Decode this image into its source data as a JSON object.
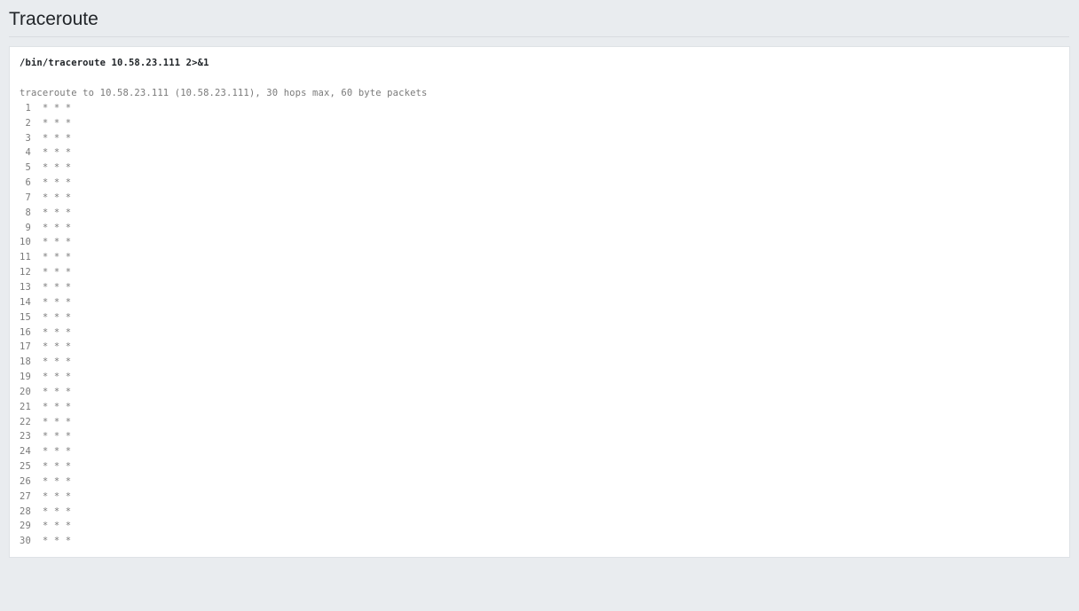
{
  "page": {
    "title": "Traceroute"
  },
  "output": {
    "command": "/bin/traceroute 10.58.23.111 2>&1",
    "header": "traceroute to 10.58.23.111 (10.58.23.111), 30 hops max, 60 byte packets",
    "hops": [
      " 1  * * *",
      " 2  * * *",
      " 3  * * *",
      " 4  * * *",
      " 5  * * *",
      " 6  * * *",
      " 7  * * *",
      " 8  * * *",
      " 9  * * *",
      "10  * * *",
      "11  * * *",
      "12  * * *",
      "13  * * *",
      "14  * * *",
      "15  * * *",
      "16  * * *",
      "17  * * *",
      "18  * * *",
      "19  * * *",
      "20  * * *",
      "21  * * *",
      "22  * * *",
      "23  * * *",
      "24  * * *",
      "25  * * *",
      "26  * * *",
      "27  * * *",
      "28  * * *",
      "29  * * *",
      "30  * * *"
    ]
  }
}
